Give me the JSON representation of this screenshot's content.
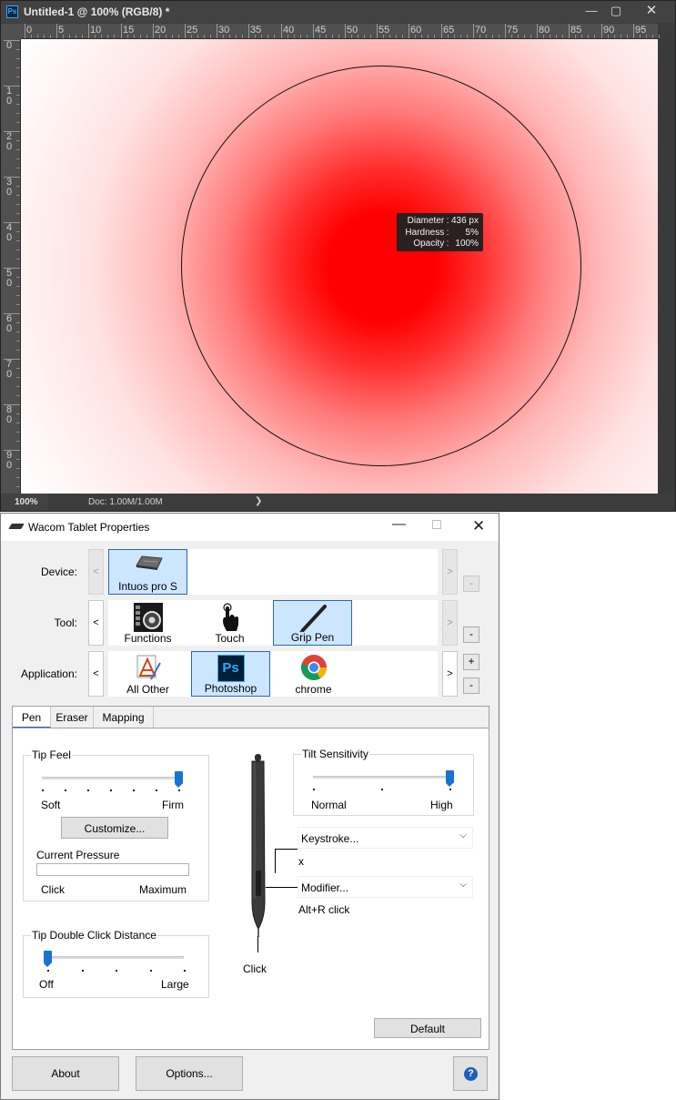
{
  "photoshop": {
    "app_icon": "Ps",
    "title": "Untitled-1 @ 100% (RGB/8) *",
    "window_controls": {
      "minimize": "—",
      "maximize": "▢",
      "close": "✕"
    },
    "ruler_top_labels": [
      "0",
      "5",
      "10",
      "15",
      "20",
      "25",
      "30",
      "35",
      "40",
      "45",
      "50",
      "55",
      "60",
      "65",
      "70",
      "75",
      "80",
      "85",
      "90",
      "95"
    ],
    "ruler_left_labels": [
      [
        "0",
        ""
      ],
      [
        "1",
        "0"
      ],
      [
        "2",
        "0"
      ],
      [
        "3",
        "0"
      ],
      [
        "4",
        "0"
      ],
      [
        "5",
        "0"
      ],
      [
        "6",
        "0"
      ],
      [
        "7",
        "0"
      ],
      [
        "8",
        "0"
      ],
      [
        "9",
        "0"
      ]
    ],
    "brush_tooltip": {
      "rows": [
        {
          "key": "Diameter",
          "sep": ":",
          "value": "436 px"
        },
        {
          "key": "Hardness",
          "sep": ":",
          "value": "5%"
        },
        {
          "key": "Opacity",
          "sep": ":",
          "value": "100%"
        }
      ]
    },
    "status": {
      "zoom": "100%",
      "doc": "Doc: 1.00M/1.00M",
      "arrow": "❯"
    },
    "colors": {
      "brush": "#ff0000",
      "chrome": "#3c3c3c"
    }
  },
  "wacom": {
    "title": "Wacom Tablet Properties",
    "controls": {
      "minimize": "—",
      "close": "✕"
    },
    "device": {
      "label": "Device:",
      "prev": "<",
      "next": ">",
      "remove": "-",
      "items": [
        {
          "label": "Intuos pro S",
          "icon": "tablet-icon",
          "selected": true
        }
      ]
    },
    "tool": {
      "label": "Tool:",
      "prev": "<",
      "next": ">",
      "remove": "-",
      "items": [
        {
          "label": "Functions",
          "icon": "functions-icon",
          "selected": false
        },
        {
          "label": "Touch",
          "icon": "touch-hand-icon",
          "selected": false
        },
        {
          "label": "Grip Pen",
          "icon": "grip-pen-icon",
          "selected": true
        }
      ]
    },
    "application": {
      "label": "Application:",
      "prev": "<",
      "next": ">",
      "add": "+",
      "remove": "-",
      "items": [
        {
          "label": "All Other",
          "icon": "all-other-apps-icon",
          "selected": false
        },
        {
          "label": "Photoshop",
          "icon": "photoshop-icon",
          "icon_text": "Ps",
          "selected": true
        },
        {
          "label": "chrome",
          "icon": "chrome-icon",
          "selected": false
        }
      ]
    },
    "tabs": [
      {
        "label": "Pen",
        "active": true
      },
      {
        "label": "Eraser",
        "active": false
      },
      {
        "label": "Mapping",
        "active": false
      }
    ],
    "pen": {
      "tip_feel": {
        "title": "Tip Feel",
        "min_label": "Soft",
        "max_label": "Firm",
        "level": 1.0,
        "customize_button": "Customize...",
        "current_pressure_label": "Current Pressure",
        "pressure_min": "Click",
        "pressure_max": "Maximum"
      },
      "tip_double_click": {
        "title": "Tip Double Click Distance",
        "min_label": "Off",
        "max_label": "Large",
        "level": 0.0
      },
      "tilt": {
        "title": "Tilt Sensitivity",
        "min_label": "Normal",
        "max_label": "High",
        "level": 1.0
      },
      "upper_button": {
        "value": "Keystroke...",
        "detail": "x"
      },
      "lower_button": {
        "value": "Modifier...",
        "detail": "Alt+R click"
      },
      "tip_label": "Click",
      "default_button": "Default"
    },
    "footer": {
      "about": "About",
      "options": "Options...",
      "help_icon": "?"
    },
    "colors": {
      "selection": "#cde6ff",
      "selection_border": "#2a64c2",
      "slider": "#1873d3"
    }
  }
}
